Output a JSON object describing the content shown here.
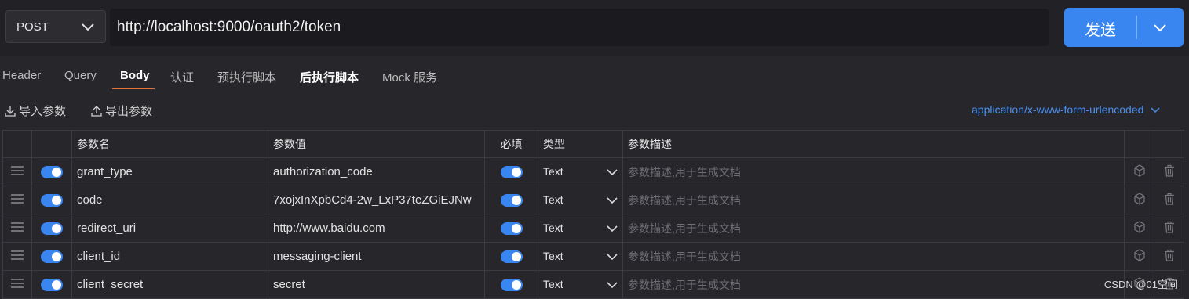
{
  "request": {
    "method": "POST",
    "url": "http://localhost:9000/oauth2/token",
    "send_label": "发送"
  },
  "tabs": [
    {
      "label": "Header"
    },
    {
      "label": "Query"
    },
    {
      "label": "Body"
    },
    {
      "label": "认证"
    },
    {
      "label": "预执行脚本"
    },
    {
      "label": "后执行脚本"
    },
    {
      "label": "Mock 服务"
    }
  ],
  "toolbar": {
    "import_label": "导入参数",
    "export_label": "导出参数",
    "content_type": "application/x-www-form-urlencoded"
  },
  "table": {
    "headers": {
      "name": "参数名",
      "value": "参数值",
      "required": "必填",
      "type": "类型",
      "desc": "参数描述"
    },
    "rows": [
      {
        "name": "grant_type",
        "value": "authorization_code",
        "type": "Text",
        "desc_placeholder": "参数描述,用于生成文档"
      },
      {
        "name": "code",
        "value": "7xojxInXpbCd4-2w_LxP37teZGiEJNw",
        "type": "Text",
        "desc_placeholder": "参数描述,用于生成文档"
      },
      {
        "name": "redirect_uri",
        "value": "http://www.baidu.com",
        "type": "Text",
        "desc_placeholder": "参数描述,用于生成文档"
      },
      {
        "name": "client_id",
        "value": "messaging-client",
        "type": "Text",
        "desc_placeholder": "参数描述,用于生成文档"
      },
      {
        "name": "client_secret",
        "value": "secret",
        "type": "Text",
        "desc_placeholder": "参数描述,用于生成文档"
      }
    ]
  },
  "watermark": "CSDN @01空间",
  "colors": {
    "accent": "#3a86f0",
    "tab_underline": "#e8723c",
    "link": "#4a90f0"
  }
}
